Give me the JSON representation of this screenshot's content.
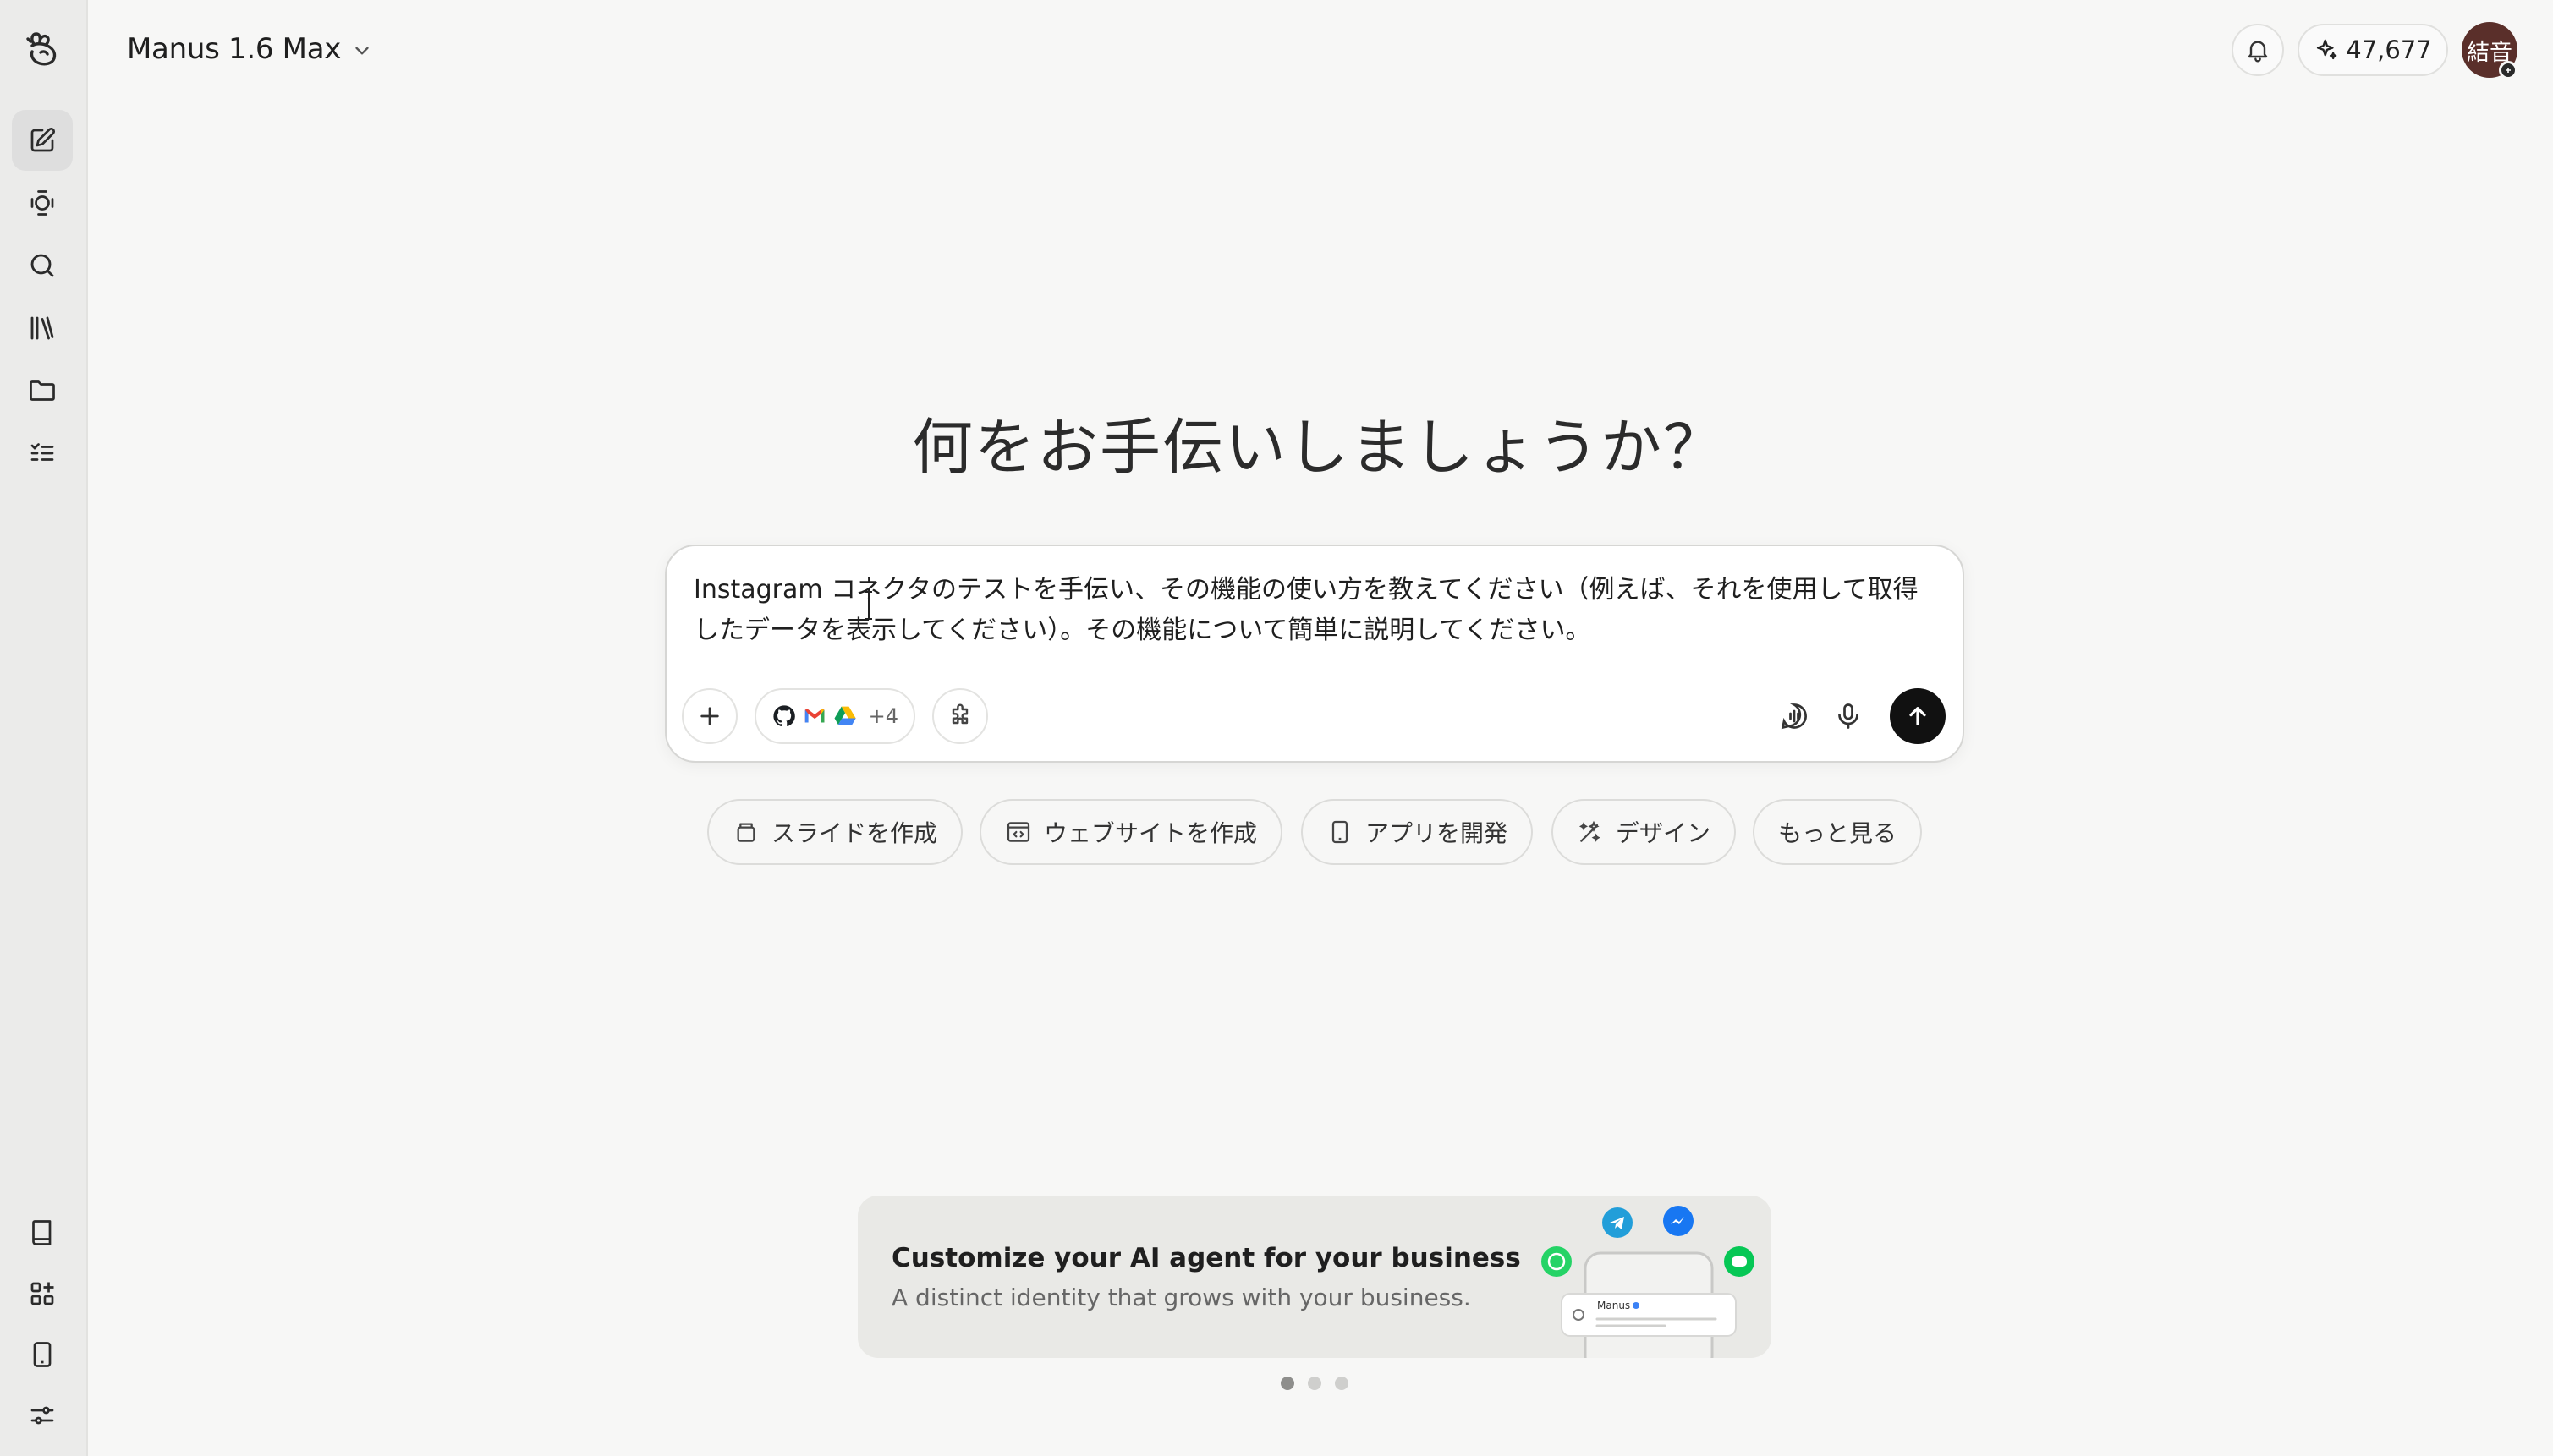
{
  "app": {
    "model_name": "Manus 1.6 Max",
    "credits": "47,677",
    "avatar_text": "結音"
  },
  "sidebar": {
    "top_items": [
      {
        "icon": "new-task-icon"
      },
      {
        "icon": "agents-icon"
      },
      {
        "icon": "search-icon"
      },
      {
        "icon": "library-icon"
      },
      {
        "icon": "folder-icon"
      },
      {
        "icon": "tasks-list-icon"
      }
    ],
    "bottom_items": [
      {
        "icon": "book-icon"
      },
      {
        "icon": "apps-icon"
      },
      {
        "icon": "mobile-icon"
      },
      {
        "icon": "settings-sliders-icon"
      }
    ]
  },
  "main": {
    "headline": "何をお手伝いしましょうか？",
    "prompt": {
      "value": "Instagram コネクタのテストを手伝い、その機能の使い方を教えてください（例えば、それを使用して取得したデータを表示してください）。その機能について簡単に説明してください。",
      "connectors_more": "+4",
      "connectors": [
        "github-icon",
        "gmail-icon",
        "google-drive-icon"
      ]
    },
    "quick_actions": [
      {
        "label": "スライドを作成",
        "icon": "slides-icon"
      },
      {
        "label": "ウェブサイトを作成",
        "icon": "website-icon"
      },
      {
        "label": "アプリを開発",
        "icon": "mobile-app-icon"
      },
      {
        "label": "デザイン",
        "icon": "design-icon"
      },
      {
        "label": "もっと見る",
        "icon": ""
      }
    ],
    "promo": {
      "title": "Customize your AI agent for your business",
      "subtitle": "A distinct identity that grows with your business.",
      "art_label": "Manus",
      "active_slide": 1,
      "slide_count": 3
    }
  },
  "colors": {
    "background": "#f7f7f6",
    "sidebar": "#ebebea",
    "send_button": "#111111",
    "avatar": "#5a2f2a"
  }
}
